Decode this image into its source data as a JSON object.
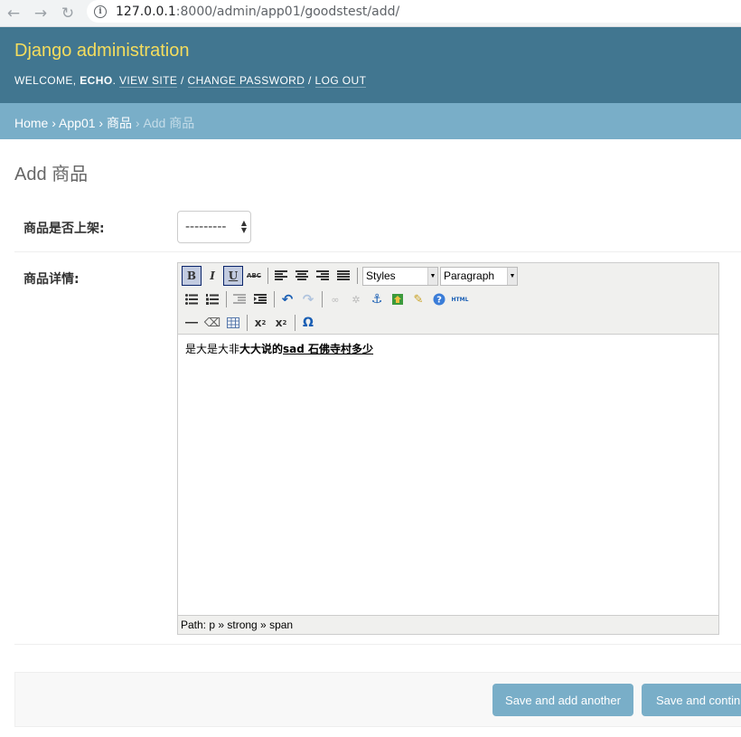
{
  "browser": {
    "url_host": "127.0.0.1",
    "url_path": ":8000/admin/app01/goodstest/add/"
  },
  "header": {
    "site_title": "Django administration",
    "welcome": "WELCOME,",
    "username": "ECHO",
    "view_site": "VIEW SITE",
    "change_password": "CHANGE PASSWORD",
    "log_out": "LOG OUT"
  },
  "breadcrumbs": {
    "home": "Home",
    "app": "App01",
    "model": "商品",
    "current": "Add 商品"
  },
  "page": {
    "title": "Add 商品"
  },
  "form": {
    "field1_label": "商品是否上架:",
    "field1_value": "---------",
    "field2_label": "商品详情:"
  },
  "editor": {
    "styles_label": "Styles",
    "format_label": "Paragraph",
    "content_plain": "是大是大非",
    "content_bold": "大大说的",
    "content_underline": "sad 石佛寺村多少",
    "path": "Path: p » strong » span"
  },
  "buttons": {
    "save_add_another": "Save and add another",
    "save_continue": "Save and continue editing"
  },
  "colors": {
    "header_bg": "#417690",
    "breadcrumb_bg": "#79aec8",
    "title_yellow": "#f5dd5d",
    "button_bg": "#79aec8"
  }
}
